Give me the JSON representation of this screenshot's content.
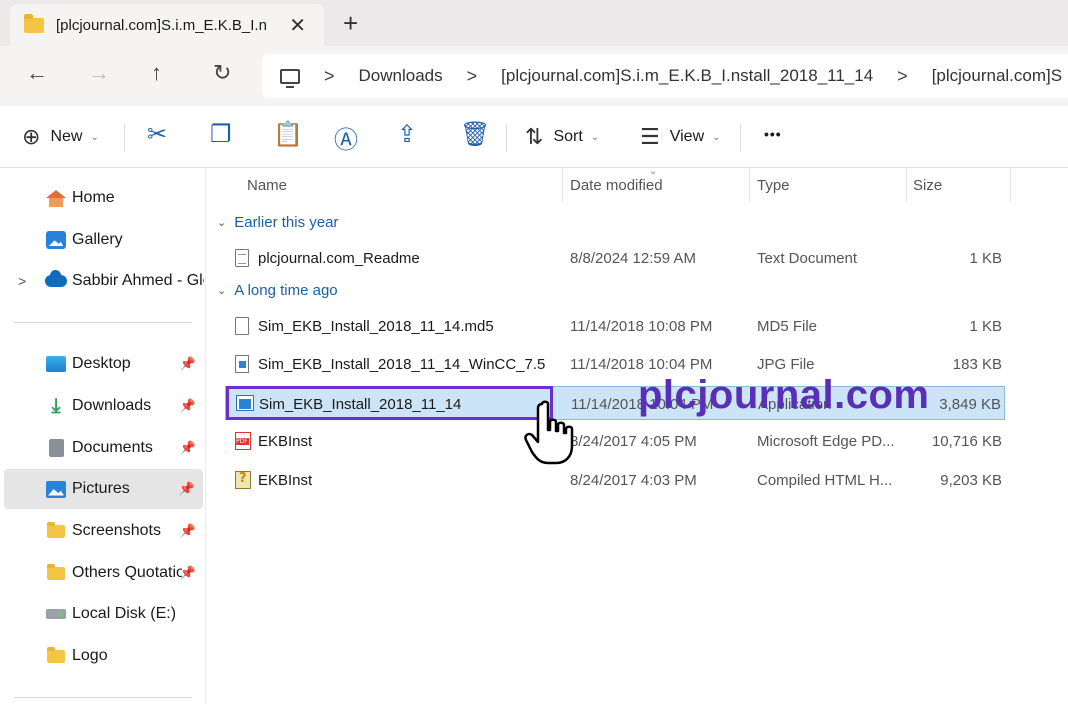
{
  "tab": {
    "title": "[plcjournal.com]S.i.m_E.K.B_I.n",
    "close_glyph": "✕",
    "new_tab_glyph": "+"
  },
  "nav": {
    "back": "←",
    "forward": "→",
    "up": "↑",
    "refresh": "↻",
    "breadcrumb": [
      "Downloads",
      "[plcjournal.com]S.i.m_E.K.B_I.nstall_2018_11_14",
      "[plcjournal.com]S"
    ],
    "separator": ">"
  },
  "toolbar": {
    "new_label": "New",
    "new_icon": "⊕",
    "sort_label": "Sort",
    "sort_icon": "⇅",
    "view_label": "View",
    "view_icon": "☰",
    "more": "•••",
    "icons": [
      "cut-icon",
      "copy-icon",
      "paste-icon",
      "rename-icon",
      "share-icon",
      "delete-icon"
    ]
  },
  "sidebar": {
    "items": [
      {
        "label": "Home",
        "icon": "home-icon"
      },
      {
        "label": "Gallery",
        "icon": "gallery-icon"
      },
      {
        "label": "Sabbir Ahmed - Glo",
        "icon": "onedrive-icon"
      },
      {
        "label": "Desktop",
        "icon": "desktop-icon",
        "pinned": true
      },
      {
        "label": "Downloads",
        "icon": "downloads-icon",
        "pinned": true
      },
      {
        "label": "Documents",
        "icon": "documents-icon",
        "pinned": true
      },
      {
        "label": "Pictures",
        "icon": "pictures-icon",
        "pinned": true,
        "selected": true
      },
      {
        "label": "Screenshots",
        "icon": "folder-icon",
        "pinned": true
      },
      {
        "label": "Others Quotatio",
        "icon": "folder-icon",
        "pinned": true
      },
      {
        "label": "Local Disk (E:)",
        "icon": "disk-icon"
      },
      {
        "label": "Logo",
        "icon": "folder-icon"
      }
    ],
    "chevron": ">",
    "pin_glyph": "📌"
  },
  "columns": {
    "name": "Name",
    "date": "Date modified",
    "type": "Type",
    "size": "Size"
  },
  "groups": [
    {
      "label": "Earlier this year",
      "files": [
        {
          "name": "plcjournal.com_Readme",
          "date": "8/8/2024 12:59 AM",
          "type": "Text Document",
          "size": "1 KB",
          "icon": "text-file-icon"
        }
      ]
    },
    {
      "label": "A long time ago",
      "files": [
        {
          "name": "Sim_EKB_Install_2018_11_14.md5",
          "date": "11/14/2018 10:08 PM",
          "type": "MD5 File",
          "size": "1 KB",
          "icon": "file-icon"
        },
        {
          "name": "Sim_EKB_Install_2018_11_14_WinCC_7.5",
          "date": "11/14/2018 10:04 PM",
          "type": "JPG File",
          "size": "183 KB",
          "icon": "jpg-file-icon"
        },
        {
          "name": "Sim_EKB_Install_2018_11_14",
          "date": "11/14/2018 10:04 PM",
          "type": "Application",
          "size": "3,849 KB",
          "icon": "application-icon",
          "selected": true
        },
        {
          "name": "EKBInst",
          "date": "8/24/2017 4:05 PM",
          "type": "Microsoft Edge PD...",
          "size": "10,716 KB",
          "icon": "pdf-file-icon"
        },
        {
          "name": "EKBInst",
          "date": "8/24/2017 4:03 PM",
          "type": "Compiled HTML H...",
          "size": "9,203 KB",
          "icon": "chm-file-icon"
        }
      ]
    }
  ],
  "group_chevron": "⌄",
  "watermark": "plcjournal.com",
  "colors": {
    "accent": "#1f5fa8",
    "selection": "#cce4f7",
    "highlight_box": "#6a2fd0",
    "watermark": "#5a2fb8"
  }
}
